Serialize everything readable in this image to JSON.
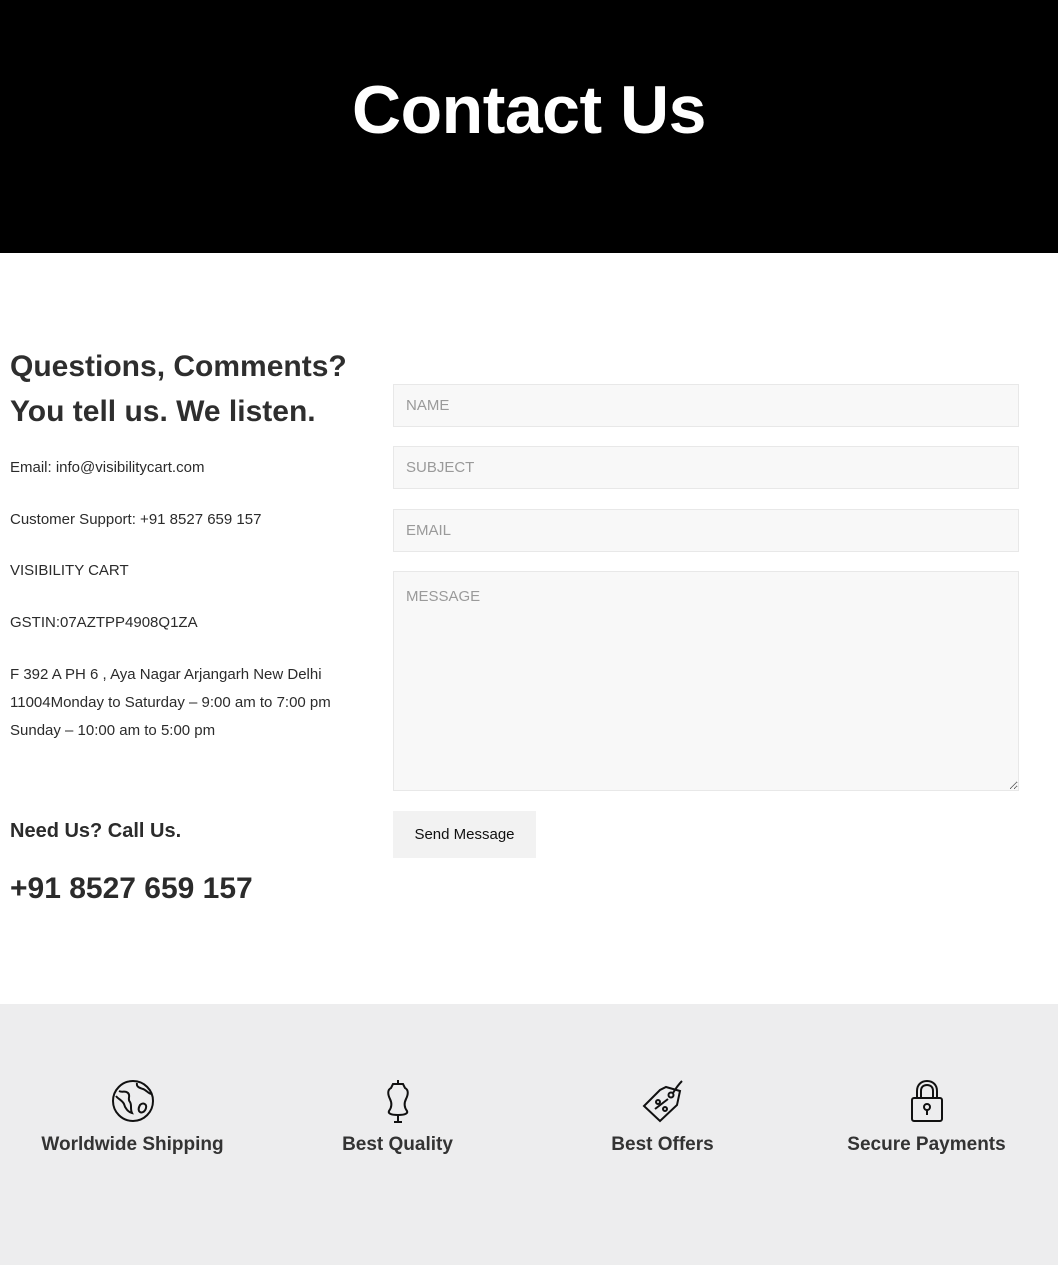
{
  "hero": {
    "title": "Contact Us"
  },
  "contact": {
    "heading_line1": "Questions, Comments?",
    "heading_line2": "You tell us. We listen.",
    "email": "Email: info@visibilitycart.com",
    "support": "Customer Support: +91 8527 659 157",
    "company": "VISIBILITY CART",
    "gstin": "GSTIN:07AZTPP4908Q1ZA",
    "address_line1": "F 392 A PH 6 , Aya Nagar Arjangarh New Delhi",
    "address_line2": "11004Monday to Saturday – 9:00 am to 7:00 pm",
    "address_line3": "Sunday – 10:00 am to 5:00 pm",
    "call_heading": "Need Us? Call Us.",
    "call_number": "+91 8527 659 157"
  },
  "form": {
    "name_placeholder": "NAME",
    "subject_placeholder": "SUBJECT",
    "email_placeholder": "EMAIL",
    "message_placeholder": "MESSAGE",
    "name_value": "",
    "subject_value": "",
    "email_value": "",
    "message_value": "",
    "submit_label": "Send Message"
  },
  "features": [
    {
      "icon": "globe-icon",
      "label": "Worldwide Shipping"
    },
    {
      "icon": "dress-form-icon",
      "label": "Best Quality"
    },
    {
      "icon": "price-tag-icon",
      "label": "Best Offers"
    },
    {
      "icon": "padlock-icon",
      "label": "Secure Payments"
    }
  ],
  "colors": {
    "hero_bg": "#000000",
    "features_bg": "#ededee",
    "field_bg": "#f8f8f8",
    "button_bg": "#f2f2f2"
  }
}
